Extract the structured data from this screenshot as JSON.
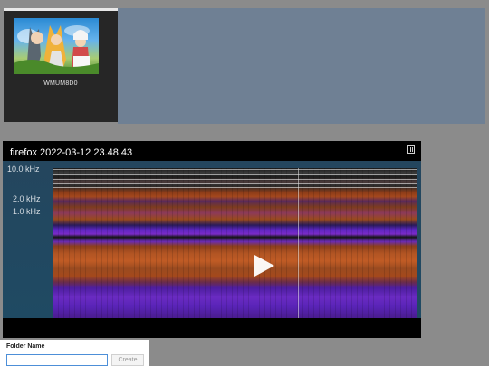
{
  "gallery": {
    "tile": {
      "caption": "WMUM8D0"
    }
  },
  "player": {
    "title": "firefox 2022-03-12 23.48.43",
    "delete_icon": "trash-icon",
    "play_icon": "play-icon",
    "frequency_labels": [
      "10.0 kHz",
      "2.0 kHz",
      "1.0 kHz"
    ]
  },
  "folder_panel": {
    "label": "Folder Name",
    "input_value": "",
    "create_label": "Create"
  },
  "colors": {
    "background": "#8b8b8b",
    "strip": "#6f8094",
    "input_focus": "#4d8fd8"
  }
}
